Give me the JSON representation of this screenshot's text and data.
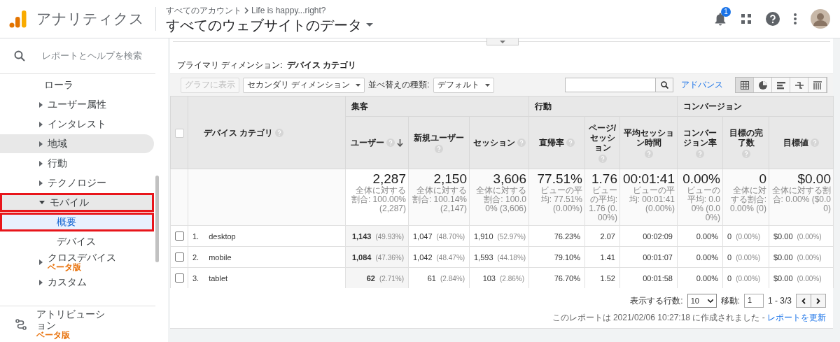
{
  "header": {
    "product": "アナリティクス",
    "account": "すべてのアカウント",
    "property": "Life is happy...right?",
    "view": "すべてのウェブサイトのデータ",
    "notification_count": "1"
  },
  "sidebar": {
    "search_placeholder": "レポートとヘルプを検索",
    "items": [
      {
        "kind": "leaf",
        "label": "ローラ",
        "selected": false,
        "highlighted": false,
        "annotated": false
      },
      {
        "kind": "group",
        "label": "ユーザー属性",
        "expanded": false,
        "highlighted": false,
        "annotated": false
      },
      {
        "kind": "group",
        "label": "インタレスト",
        "expanded": false,
        "highlighted": false,
        "annotated": false
      },
      {
        "kind": "group",
        "label": "地域",
        "expanded": false,
        "highlighted": true,
        "annotated": false
      },
      {
        "kind": "group",
        "label": "行動",
        "expanded": false,
        "highlighted": false,
        "annotated": false
      },
      {
        "kind": "group",
        "label": "テクノロジー",
        "expanded": false,
        "highlighted": false,
        "annotated": false
      },
      {
        "kind": "group",
        "label": "モバイル",
        "expanded": true,
        "highlighted": true,
        "annotated": true,
        "children": [
          {
            "kind": "leaf",
            "label": "概要",
            "selected": true,
            "highlighted": false,
            "annotated": true
          },
          {
            "kind": "leaf",
            "label": "デバイス",
            "selected": false,
            "highlighted": false,
            "annotated": false
          }
        ]
      },
      {
        "kind": "group",
        "label": "クロスデバイス",
        "badge": "ベータ版",
        "expanded": false,
        "highlighted": false,
        "annotated": false
      },
      {
        "kind": "group",
        "label": "カスタム",
        "expanded": false,
        "highlighted": false,
        "annotated": false
      }
    ],
    "attribution": {
      "label": "アトリビューション",
      "badge": "ベータ版"
    }
  },
  "report": {
    "primary_dimension_label": "プライマリ ディメンション:",
    "primary_dimension": "デバイス カテゴリ",
    "toolbar": {
      "chart_button": {
        "label": "グラフに表示",
        "disabled": true
      },
      "secondary_dimension": "セカンダリ ディメンション",
      "sort_label": "並べ替えの種類:",
      "sort_value": "デフォルト",
      "advanced": "アドバンス",
      "views": [
        {
          "kind": "table",
          "selected": true
        },
        {
          "kind": "pie",
          "selected": false
        },
        {
          "kind": "bars",
          "selected": false
        },
        {
          "kind": "comparison",
          "selected": false
        },
        {
          "kind": "pivot",
          "selected": false
        }
      ]
    },
    "table": {
      "all_selected": false,
      "dimension": "デバイス カテゴリ",
      "groups": [
        {
          "label": "集客",
          "columns": [
            {
              "label": "ユーザー",
              "sorted": true
            },
            {
              "label": "新規ユーザー",
              "sorted": false
            },
            {
              "label": "セッション",
              "sorted": false
            }
          ]
        },
        {
          "label": "行動",
          "columns": [
            {
              "label": "直帰率",
              "sorted": false
            },
            {
              "label": "ページ/セッション",
              "sorted": false
            },
            {
              "label": "平均セッション時間",
              "sorted": false
            }
          ]
        },
        {
          "label": "コンバージョン",
          "columns": [
            {
              "label": "コンバージョン率",
              "sorted": false
            },
            {
              "label": "目標の完了数",
              "sorted": false
            },
            {
              "label": "目標値",
              "sorted": false
            }
          ]
        }
      ],
      "totals": [
        {
          "value": "2,287",
          "note": "全体に対する割合: 100.00% (2,287)"
        },
        {
          "value": "2,150",
          "note": "全体に対する割合: 100.14% (2,147)"
        },
        {
          "value": "3,606",
          "note": "全体に対する割合: 100.00% (3,606)"
        },
        {
          "value": "77.51%",
          "note": "ビューの平均: 77.51% (0.00%)"
        },
        {
          "value": "1.76",
          "note": "ビューの平均: 1.76 (0.00%)"
        },
        {
          "value": "00:01:41",
          "note": "ビューの平均: 00:01:41 (0.00%)"
        },
        {
          "value": "0.00%",
          "note": "ビューの平均: 0.00% (0.00%)"
        },
        {
          "value": "0",
          "note": "全体に対する割合: 0.00% (0)"
        },
        {
          "value": "$0.00",
          "note": "全体に対する割合: 0.00% ($0.00)"
        }
      ],
      "rows": [
        {
          "index": "1.",
          "name": "desktop",
          "selected": false,
          "cells": [
            {
              "value": "1,143",
              "pct": "(49.93%)"
            },
            {
              "value": "1,047",
              "pct": "(48.70%)"
            },
            {
              "value": "1,910",
              "pct": "(52.97%)"
            },
            {
              "value": "76.23%"
            },
            {
              "value": "2.07"
            },
            {
              "value": "00:02:09"
            },
            {
              "value": "0.00%"
            },
            {
              "value": "0",
              "pct": "(0.00%)"
            },
            {
              "value": "$0.00",
              "pct": "(0.00%)"
            }
          ]
        },
        {
          "index": "2.",
          "name": "mobile",
          "selected": false,
          "cells": [
            {
              "value": "1,084",
              "pct": "(47.36%)"
            },
            {
              "value": "1,042",
              "pct": "(48.47%)"
            },
            {
              "value": "1,593",
              "pct": "(44.18%)"
            },
            {
              "value": "79.10%"
            },
            {
              "value": "1.41"
            },
            {
              "value": "00:01:07"
            },
            {
              "value": "0.00%"
            },
            {
              "value": "0",
              "pct": "(0.00%)"
            },
            {
              "value": "$0.00",
              "pct": "(0.00%)"
            }
          ]
        },
        {
          "index": "3.",
          "name": "tablet",
          "selected": false,
          "cells": [
            {
              "value": "62",
              "pct": "(2.71%)"
            },
            {
              "value": "61",
              "pct": "(2.84%)"
            },
            {
              "value": "103",
              "pct": "(2.86%)"
            },
            {
              "value": "76.70%"
            },
            {
              "value": "1.52"
            },
            {
              "value": "00:01:58"
            },
            {
              "value": "0.00%"
            },
            {
              "value": "0",
              "pct": "(0.00%)"
            },
            {
              "value": "$0.00",
              "pct": "(0.00%)"
            }
          ]
        }
      ]
    },
    "pagination": {
      "rows_label": "表示する行数:",
      "rows_value": "10",
      "goto_label": "移動:",
      "goto_value": "1",
      "range": "1 - 3/3"
    },
    "footer": {
      "text": "このレポートは 2021/02/06 10:27:18 に作成されました - ",
      "link": "レポートを更新"
    }
  }
}
